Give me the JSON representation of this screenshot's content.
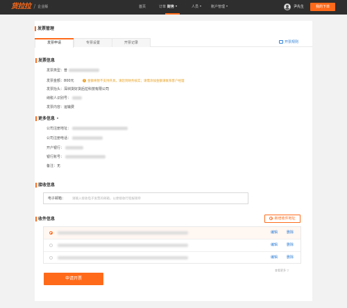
{
  "header": {
    "logo_text": "货拉拉",
    "edition": "企业版",
    "nav": [
      {
        "label": "首页"
      },
      {
        "label": "订单"
      },
      {
        "label": "财务"
      },
      {
        "label": "人员"
      },
      {
        "label": "账户管理"
      }
    ],
    "active_nav": "财务",
    "user_name": "尹先生",
    "order_button": "我的下单"
  },
  "page": {
    "title": "发票管理",
    "tabs": [
      {
        "label": "发票申请",
        "active": true
      },
      {
        "label": "专票设置",
        "active": false
      },
      {
        "label": "开票记录",
        "active": false
      }
    ],
    "help_link": "开票规则"
  },
  "invoice_info": {
    "title": "发票信息",
    "type_label": "发票类型：",
    "type_prefix": "普",
    "amount_label": "发票金额：",
    "amount_value": "800元",
    "amount_warning": "金额将暂不支持开具，请您到财务核实；请需添加金额请联系客户经理",
    "title_label": "发票抬头：",
    "title_value": "深圳货好货后拉科技有限公司",
    "tax_id_label": "纳税人识别号：",
    "content_label": "发票内容：",
    "content_value": "运输费"
  },
  "more_info": {
    "title": "更多信息",
    "company_address_label": "公司注册地址：",
    "company_phone_label": "公司注册电话：",
    "bank_label": "开户银行：",
    "account_label": "银行账号：",
    "remark_label": "备注：",
    "remark_value": "无"
  },
  "receive_info": {
    "title": "接收信息",
    "email_label": "电子邮箱：",
    "email_placeholder": "请输入接收电子发票的邮箱，以便接收行程报销单"
  },
  "mail_info": {
    "title": "收件信息",
    "add_button": "新增收件地址",
    "rows": [
      {
        "edit": "编辑",
        "delete": "删除",
        "selected": true
      },
      {
        "edit": "编辑",
        "delete": "删除",
        "selected": false
      },
      {
        "edit": "编辑",
        "delete": "删除",
        "selected": false
      }
    ],
    "more_link": "查看更多 ▽"
  },
  "submit_button": "申请开票",
  "colors": {
    "accent": "#ff6a1a",
    "link": "#2f7fd6",
    "warning": "#e8a020",
    "topbar": "#2e2e2e"
  }
}
